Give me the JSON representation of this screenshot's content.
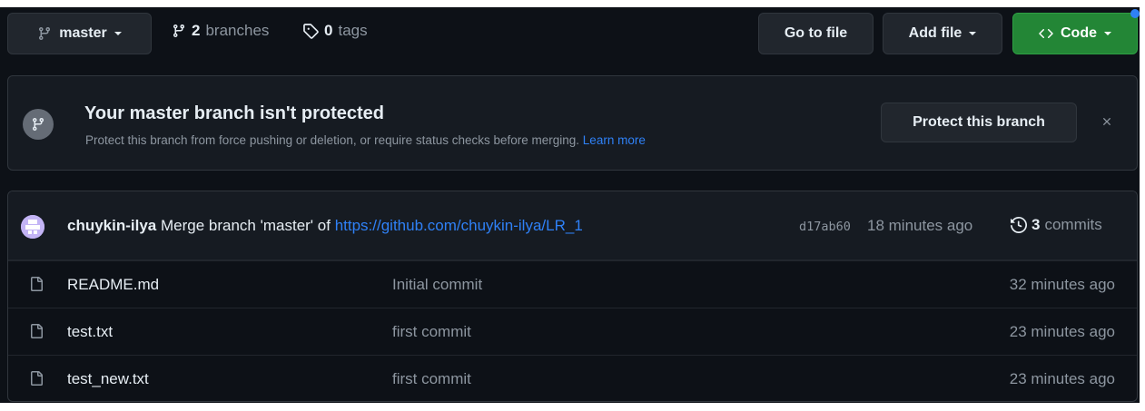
{
  "toolbar": {
    "branch_label": "master",
    "branches_count": "2",
    "branches_label": "branches",
    "tags_count": "0",
    "tags_label": "tags",
    "go_to_file": "Go to file",
    "add_file": "Add file",
    "code": "Code"
  },
  "banner": {
    "title": "Your master branch isn't protected",
    "description": "Protect this branch from force pushing or deletion, or require status checks before merging.",
    "learn_more": "Learn more",
    "protect_button": "Protect this branch"
  },
  "latest_commit": {
    "author": "chuykin-ilya",
    "message": "Merge branch 'master' of",
    "link": "https://github.com/chuykin-ilya/LR_1",
    "sha": "d17ab60",
    "age": "18 minutes ago",
    "commits_count": "3",
    "commits_label": "commits"
  },
  "files": [
    {
      "name": "README.md",
      "message": "Initial commit",
      "age": "32 minutes ago"
    },
    {
      "name": "test.txt",
      "message": "first commit",
      "age": "23 minutes ago"
    },
    {
      "name": "test_new.txt",
      "message": "first commit",
      "age": "23 minutes ago"
    }
  ],
  "colors": {
    "background": "#0d1117",
    "panel": "#161b22",
    "border": "#30363d",
    "text": "#e6edf3",
    "muted": "#8d96a0",
    "link": "#2f81f7",
    "code_button": "#238636"
  },
  "icons": {
    "branch": "git-branch-icon",
    "tag": "tag-icon",
    "code": "code-icon",
    "close": "close-icon",
    "history": "history-icon",
    "file": "file-icon"
  }
}
